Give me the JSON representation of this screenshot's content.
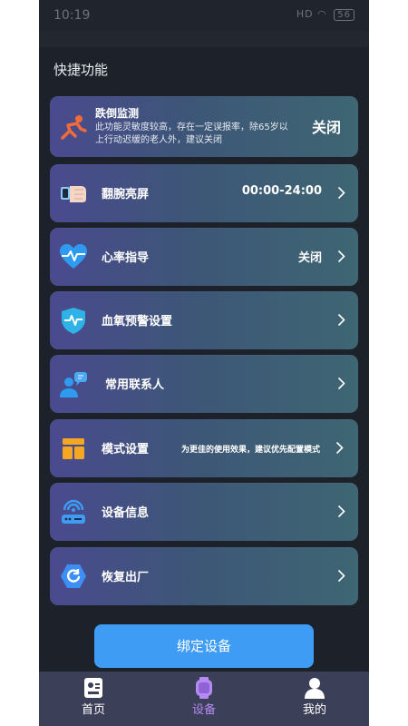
{
  "status_bar": {
    "time": "10:19",
    "signal_text": "HD",
    "battery": "56"
  },
  "section": {
    "title": "快捷功能"
  },
  "fall_detection": {
    "title": "跌倒监测",
    "description": "此功能灵敏度较高，存在一定误报率，除65岁以上行动迟缓的老人外，建议关闭",
    "value": "关闭"
  },
  "items": [
    {
      "label": "翻腕亮屏",
      "value": "00:00-24:00",
      "icon": "wrist-raise-icon"
    },
    {
      "label": "心率指导",
      "value": "关闭",
      "icon": "heart-rate-icon"
    },
    {
      "label": "血氧预警设置",
      "value": "",
      "icon": "blood-oxygen-shield-icon"
    },
    {
      "label": "常用联系人",
      "value": "",
      "icon": "contacts-icon"
    },
    {
      "label": "模式设置",
      "value": "为更佳的使用效果，建议优先配置模式",
      "icon": "mode-layout-icon"
    },
    {
      "label": "设备信息",
      "value": "",
      "icon": "device-info-icon"
    },
    {
      "label": "恢复出厂",
      "value": "",
      "icon": "factory-reset-icon"
    }
  ],
  "bind_button": {
    "label": "绑定设备"
  },
  "tabs": [
    {
      "label": "首页",
      "icon": "home-card-icon",
      "active": false
    },
    {
      "label": "设备",
      "icon": "watch-icon",
      "active": true
    },
    {
      "label": "我的",
      "icon": "person-icon",
      "active": false
    }
  ],
  "colors": {
    "background": "#1d2129",
    "card_gradient_start": "#4a4a8f",
    "card_gradient_end": "#3e6673",
    "primary_button": "#3e9cf5",
    "tab_active": "#b58bf1",
    "fall_icon": "#f26b3a",
    "heart_icon": "#2e9bf0"
  }
}
